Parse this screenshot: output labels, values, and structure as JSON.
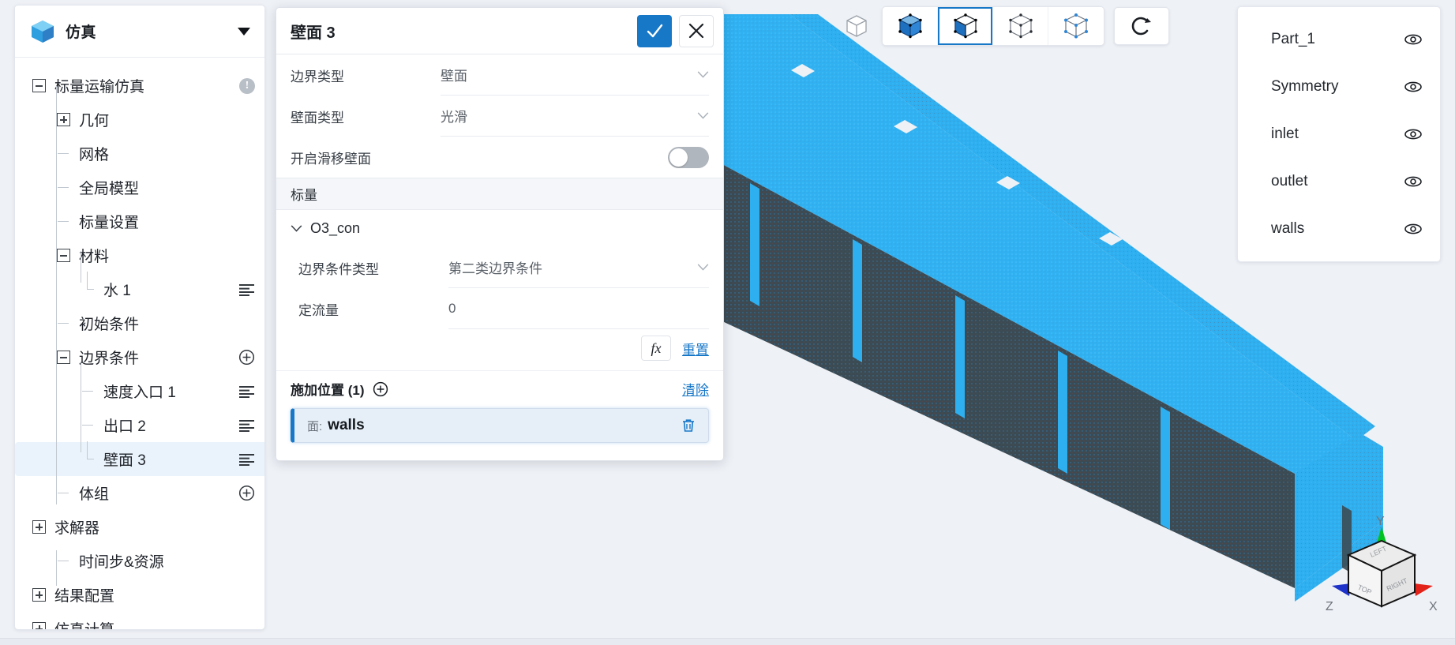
{
  "app": {
    "logo_icon": "cube-logo-icon",
    "title": "仿真",
    "caret_icon": "chevron-down-icon"
  },
  "sidebar": {
    "tree": [
      {
        "label": "标量运输仿真",
        "toggle": "minus",
        "depth": 0,
        "badge": "!",
        "action": "none"
      },
      {
        "label": "几何",
        "toggle": "plus",
        "depth": 1,
        "action": "none"
      },
      {
        "label": "网格",
        "toggle": "none",
        "depth": 1,
        "action": "none"
      },
      {
        "label": "全局模型",
        "toggle": "none",
        "depth": 1,
        "action": "none"
      },
      {
        "label": "标量设置",
        "toggle": "none",
        "depth": 1,
        "action": "none"
      },
      {
        "label": "材料",
        "toggle": "minus",
        "depth": 1,
        "action": "none"
      },
      {
        "label": "水 1",
        "toggle": "elbow",
        "depth": 2,
        "action": "list"
      },
      {
        "label": "初始条件",
        "toggle": "none",
        "depth": 1,
        "action": "none"
      },
      {
        "label": "边界条件",
        "toggle": "minus",
        "depth": 1,
        "action": "plus"
      },
      {
        "label": "速度入口 1",
        "toggle": "none",
        "depth": 2,
        "action": "list"
      },
      {
        "label": "出口 2",
        "toggle": "none",
        "depth": 2,
        "action": "list"
      },
      {
        "label": "壁面 3",
        "toggle": "elbow",
        "depth": 2,
        "action": "list",
        "selected": true
      },
      {
        "label": "体组",
        "toggle": "none",
        "depth": 1,
        "action": "plus"
      },
      {
        "label": "求解器",
        "toggle": "plus",
        "depth": 0,
        "action": "none"
      },
      {
        "label": "时间步&资源",
        "toggle": "none",
        "depth": 1,
        "action": "none"
      },
      {
        "label": "结果配置",
        "toggle": "plus",
        "depth": 0,
        "action": "none"
      },
      {
        "label": "仿真计算",
        "toggle": "plus",
        "depth": 0,
        "action": "none"
      }
    ]
  },
  "dialog": {
    "title": "壁面 3",
    "confirm_icon": "check-icon",
    "cancel_icon": "close-icon",
    "fields": [
      {
        "label": "边界类型",
        "value": "壁面",
        "control": "select"
      },
      {
        "label": "壁面类型",
        "value": "光滑",
        "control": "select"
      },
      {
        "label": "开启滑移壁面",
        "value": "off",
        "control": "toggle"
      }
    ],
    "scalar_section_title": "标量",
    "scalar_group": {
      "name": "O3_con",
      "chevron_icon": "chevron-down-icon",
      "fields": [
        {
          "label": "边界条件类型",
          "value": "第二类边界条件",
          "control": "select"
        },
        {
          "label": "定流量",
          "value": "0",
          "control": "input",
          "placeholder": "0"
        }
      ],
      "fx_label": "fx",
      "reset_label": "重置"
    },
    "location": {
      "title": "施加位置 (1)",
      "add_icon": "plus-circle-icon",
      "clear_label": "清除",
      "items": [
        {
          "kind": "面:",
          "name": "walls",
          "delete_icon": "trash-icon"
        }
      ]
    }
  },
  "toolbar": {
    "buttons": [
      {
        "name": "box-outline-button",
        "icon": "cube-outline-icon",
        "active": false,
        "grouped": false
      },
      {
        "name": "select-volume-button",
        "icon": "cube-solid-icon",
        "active": false,
        "grouped": true
      },
      {
        "name": "select-face-button",
        "icon": "cube-face-icon",
        "active": true,
        "grouped": true
      },
      {
        "name": "select-edge-button",
        "icon": "cube-edge-icon",
        "active": false,
        "grouped": true
      },
      {
        "name": "select-vertex-button",
        "icon": "cube-vertex-icon",
        "active": false,
        "grouped": true
      },
      {
        "name": "reset-view-button",
        "icon": "refresh-icon",
        "active": false,
        "grouped": false
      }
    ]
  },
  "parts_panel": {
    "items": [
      {
        "name": "Part_1",
        "visibility_icon": "eye-icon",
        "visible": true
      },
      {
        "name": "Symmetry",
        "visibility_icon": "eye-icon",
        "visible": true
      },
      {
        "name": "inlet",
        "visibility_icon": "eye-icon",
        "visible": true
      },
      {
        "name": "outlet",
        "visibility_icon": "eye-icon",
        "visible": true
      },
      {
        "name": "walls",
        "visibility_icon": "eye-icon",
        "visible": true
      }
    ]
  },
  "navcube": {
    "axis_x": "X",
    "axis_y": "Y",
    "axis_z": "Z",
    "faces": [
      "TOP",
      "LEFT",
      "RIGHT"
    ],
    "colors": {
      "x": "#e2231a",
      "y": "#00c321",
      "z": "#1d32c8"
    }
  },
  "colors": {
    "accent": "#1878c8",
    "viewport_bg": "#eef1f6",
    "mesh_highlight": "#2eaff0",
    "mesh_dark": "#3b4a52",
    "panel_bg": "#ffffff",
    "selected_row": "#eaf3fb"
  }
}
